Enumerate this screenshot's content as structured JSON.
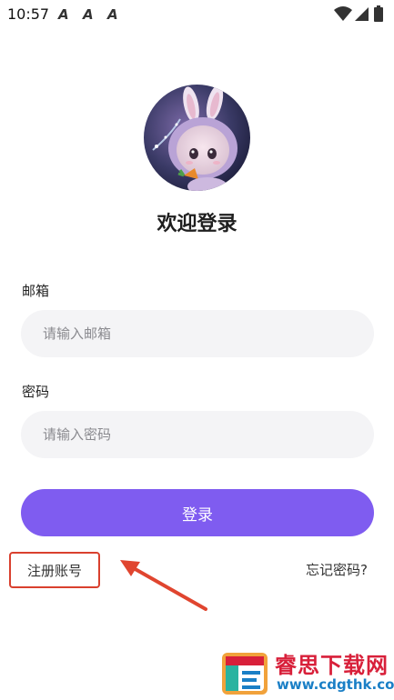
{
  "status_bar": {
    "time": "10:57",
    "notif_icons": [
      "A",
      "A",
      "A"
    ]
  },
  "header": {
    "title": "欢迎登录"
  },
  "form": {
    "email_label": "邮箱",
    "email_placeholder": "请输入邮箱",
    "password_label": "密码",
    "password_placeholder": "请输入密码",
    "login_label": "登录"
  },
  "links": {
    "register": "注册账号",
    "forgot": "忘记密码?"
  },
  "watermark": {
    "name": "睿思下载网",
    "url": "www.cdgthk.com"
  },
  "colors": {
    "accent": "#7f5cf0",
    "highlight_box": "#d9402e",
    "input_bg": "#f4f4f6"
  }
}
